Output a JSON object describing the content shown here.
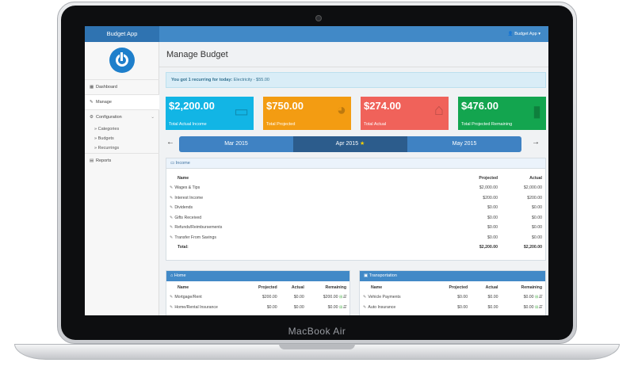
{
  "device": {
    "label": "MacBook Air"
  },
  "app": {
    "title": "Budget App",
    "user_menu": "Budget App ▾"
  },
  "sidebar": {
    "items": [
      {
        "icon": "dashboard-icon",
        "glyph": "▦",
        "label": "Dashboard"
      },
      {
        "icon": "edit-icon",
        "glyph": "✎",
        "label": "Manage"
      },
      {
        "icon": "gears-icon",
        "glyph": "⚙",
        "label": "Configuration",
        "caret": "⌄"
      },
      {
        "icon": "reports-icon",
        "glyph": "▤",
        "label": "Reports"
      }
    ],
    "subitems": [
      "Categories",
      "Budgets",
      "Recurrings"
    ],
    "sub_bullet": "»"
  },
  "page": {
    "title": "Manage Budget"
  },
  "alert": {
    "bold": "You got 1 recurring for today:",
    "text": " Electricity - $55.00"
  },
  "tiles": [
    {
      "value": "$2,200.00",
      "label": "Total Actual Income",
      "color": "#12b5e5",
      "icon": "money-icon",
      "glyph": "▭"
    },
    {
      "value": "$750.00",
      "label": "Total Projected",
      "color": "#f39c12",
      "icon": "pie-chart-icon",
      "glyph": "◕"
    },
    {
      "value": "$274.00",
      "label": "Total Actual",
      "color": "#f0625a",
      "icon": "shopping-bag-icon",
      "glyph": "⌂"
    },
    {
      "value": "$476.00",
      "label": "Total Projected Remaining",
      "color": "#13a54f",
      "icon": "bar-chart-icon",
      "glyph": "▮"
    }
  ],
  "months": {
    "prev_arrow": "←",
    "next_arrow": "→",
    "items": [
      "Mar 2015",
      "Apr 2015",
      "May 2015"
    ],
    "current_star": "★"
  },
  "income": {
    "title": "Income",
    "headers": {
      "name": "Name",
      "projected": "Projected",
      "actual": "Actual"
    },
    "rows": [
      {
        "name": "Wages & Tips",
        "projected": "$2,000.00",
        "actual": "$2,000.00"
      },
      {
        "name": "Interest Income",
        "projected": "$200.00",
        "actual": "$200.00"
      },
      {
        "name": "Dividends",
        "projected": "$0.00",
        "actual": "$0.00"
      },
      {
        "name": "Gifts Received",
        "projected": "$0.00",
        "actual": "$0.00"
      },
      {
        "name": "Refunds/Reimbursements",
        "projected": "$0.00",
        "actual": "$0.00"
      },
      {
        "name": "Transfer From Savings",
        "projected": "$0.00",
        "actual": "$0.00"
      }
    ],
    "total": {
      "label": "Total:",
      "projected": "$2,200.00",
      "actual": "$2,200.00"
    }
  },
  "home": {
    "title": "Home",
    "headers": {
      "name": "Name",
      "projected": "Projected",
      "actual": "Actual",
      "remaining": "Remaining"
    },
    "rows": [
      {
        "name": "Mortgage/Rent",
        "projected": "$200.00",
        "actual": "$0.00",
        "remaining": "$200.00"
      },
      {
        "name": "Home/Rental Insurance",
        "projected": "$0.00",
        "actual": "$0.00",
        "remaining": "$0.00"
      }
    ]
  },
  "transportation": {
    "title": "Transportation",
    "headers": {
      "name": "Name",
      "projected": "Projected",
      "actual": "Actual",
      "remaining": "Remaining"
    },
    "rows": [
      {
        "name": "Vehicle Payments",
        "projected": "$0.00",
        "actual": "$0.00",
        "remaining": "$0.00"
      },
      {
        "name": "Auto Insurance",
        "projected": "$0.00",
        "actual": "$0.00",
        "remaining": "$0.00"
      }
    ]
  }
}
